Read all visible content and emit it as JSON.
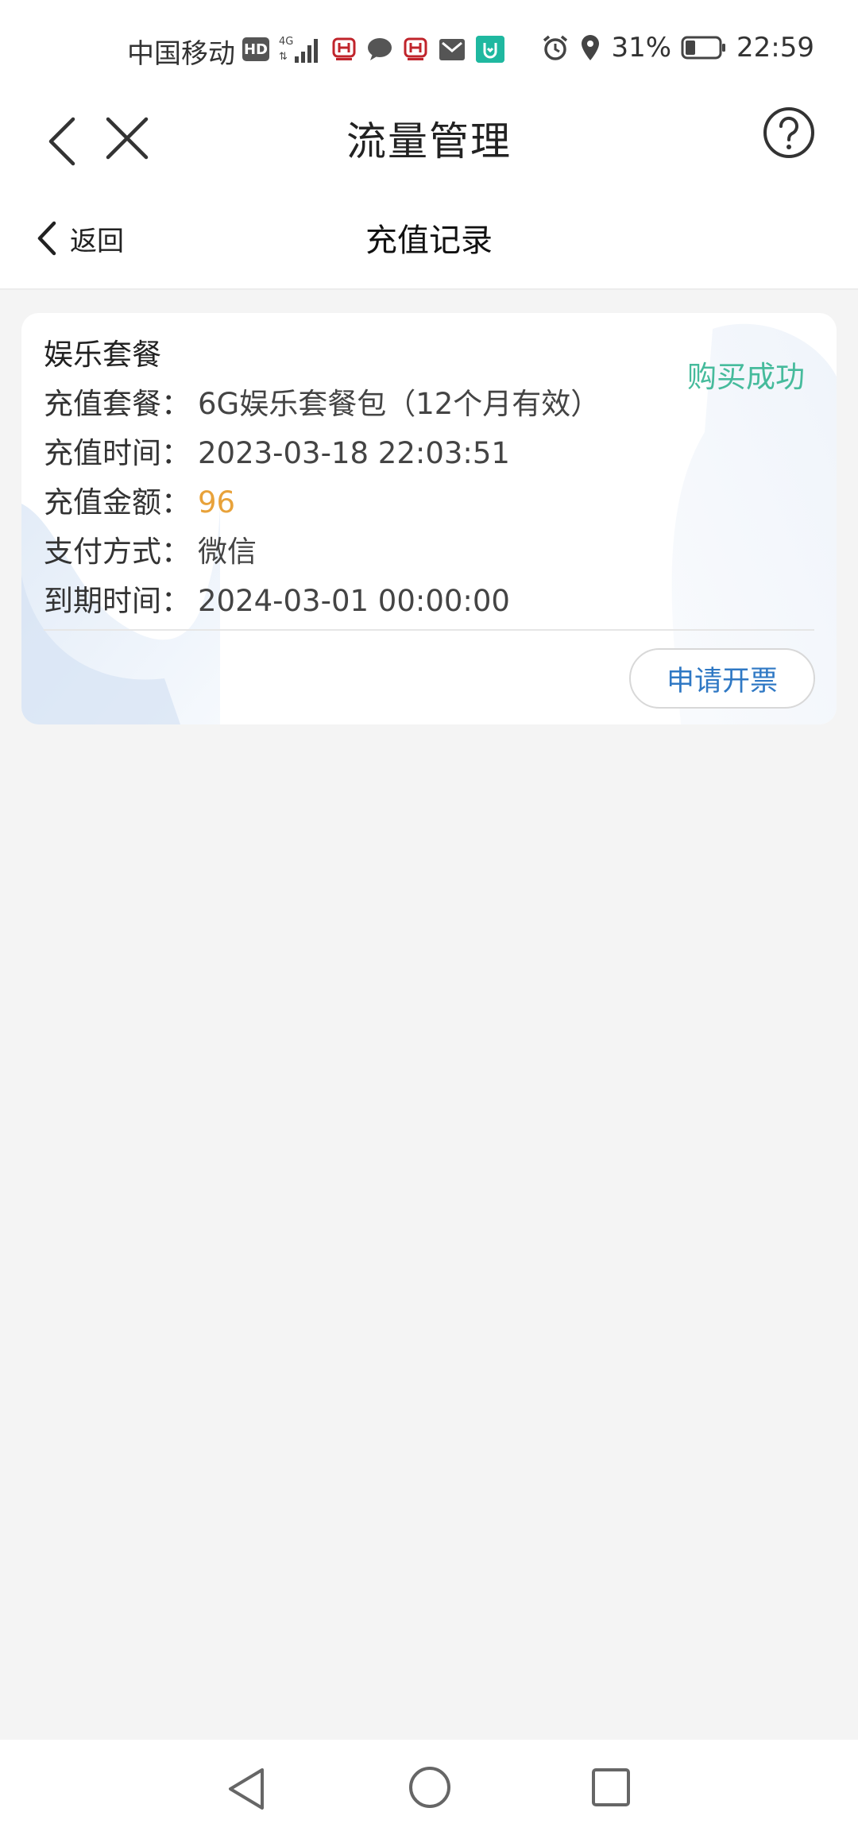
{
  "status_bar": {
    "carrier": "中国移动",
    "hd": "HD",
    "battery_percent": "31%",
    "battery_level": 0.31,
    "time": "22:59"
  },
  "header": {
    "title": "流量管理"
  },
  "sub_header": {
    "back_label": "返回",
    "title": "充值记录"
  },
  "record": {
    "package_name": "娱乐套餐",
    "status": "购买成功",
    "rows": [
      {
        "label": "充值套餐：",
        "value": "6G娱乐套餐包（12个月有效）"
      },
      {
        "label": "充值时间：",
        "value": "2023-03-18 22:03:51"
      },
      {
        "label": "充值金额：",
        "value": "96"
      },
      {
        "label": "支付方式：",
        "value": "微信"
      },
      {
        "label": "到期时间：",
        "value": "2024-03-01 00:00:00"
      }
    ],
    "invoice_button": "申请开票"
  },
  "colors": {
    "status_green": "#46bb9c",
    "amount_orange": "#e8a23a",
    "invoice_blue": "#2f78c4",
    "background": "#f4f4f4"
  },
  "icons": {
    "header_left": [
      "back-icon",
      "close-icon"
    ],
    "header_right": "help-icon",
    "nav": [
      "nav-back-icon",
      "nav-home-icon",
      "nav-recent-icon"
    ]
  }
}
